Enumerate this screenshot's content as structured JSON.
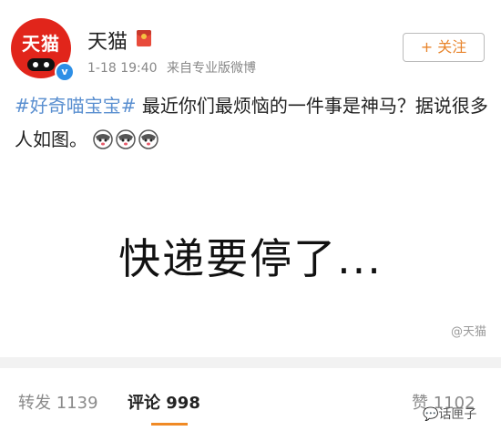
{
  "post": {
    "author": {
      "avatar_text": "天猫",
      "name": "天猫",
      "verified_mark": "v"
    },
    "meta": {
      "time": "1-18 19:40",
      "source": "来自专业版微博"
    },
    "follow_label": "+ 关注",
    "hashtag": "#好奇喵宝宝#",
    "text": "最近你们最烦恼的一件事是神马？据说很多人如图。",
    "image": {
      "caption": "快递要停了...",
      "watermark": "@天猫"
    }
  },
  "actions": {
    "repost_label": "转发",
    "repost_count": "1139",
    "comment_label": "评论",
    "comment_count": "998",
    "like_label": "赞",
    "like_count": "1102"
  },
  "footer_watermark": "话匣子",
  "colors": {
    "brand": "#e1251b",
    "hashtag": "#5a8fd0",
    "accent": "#f08a25"
  }
}
